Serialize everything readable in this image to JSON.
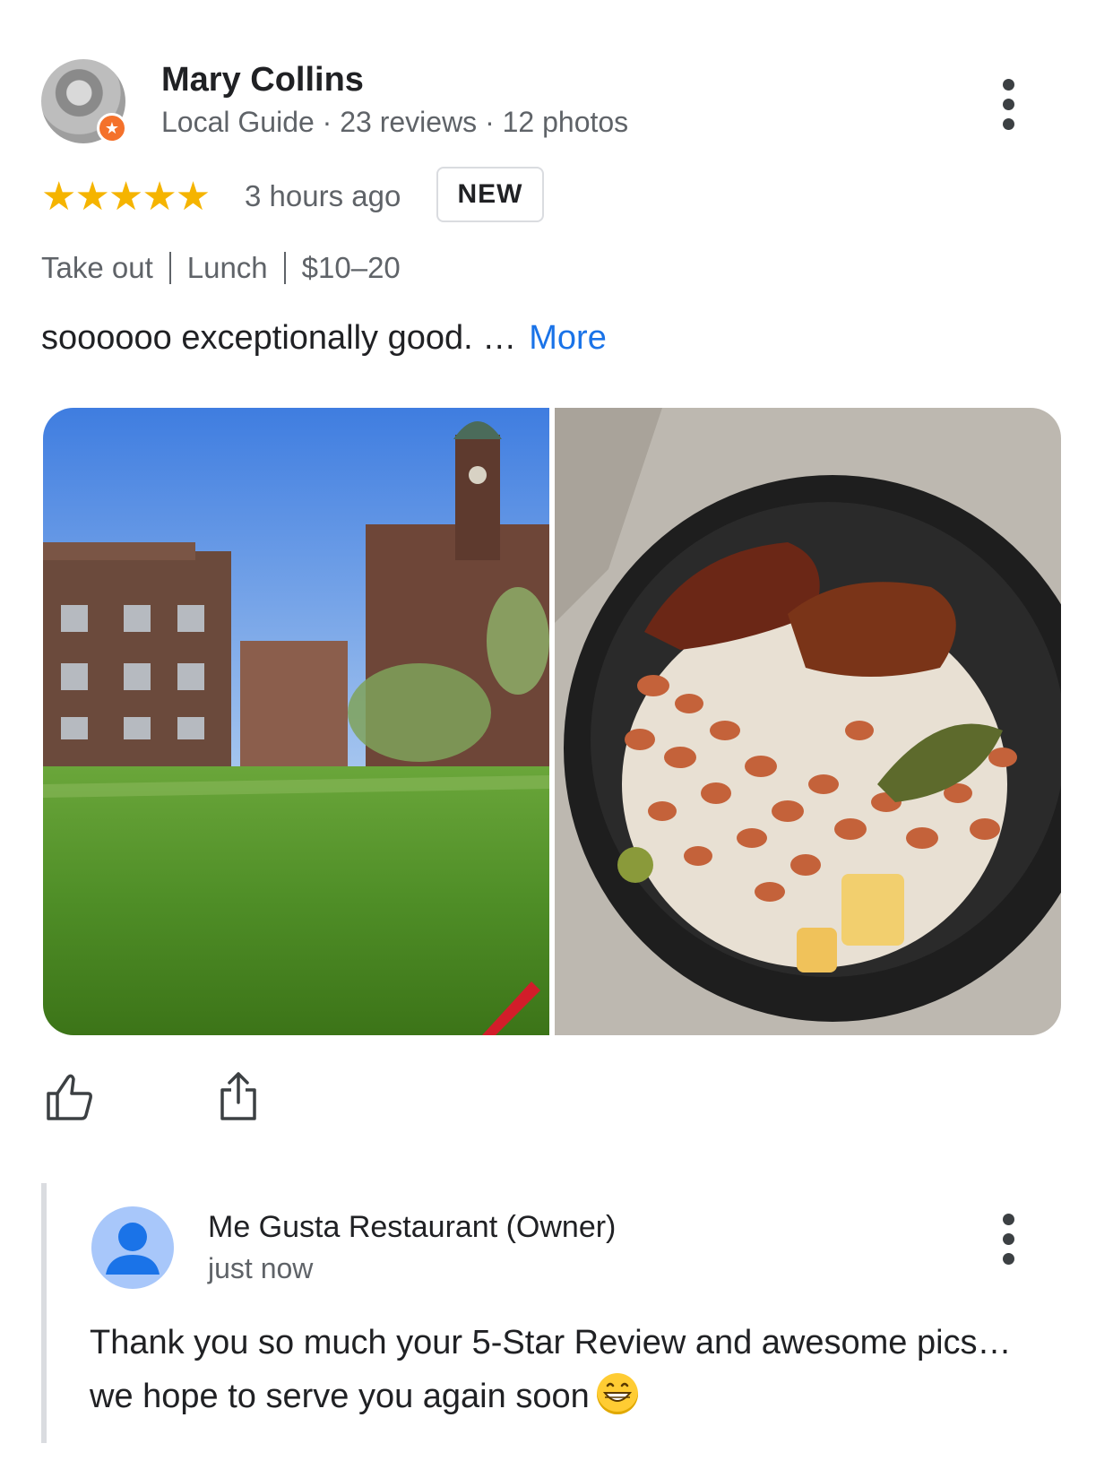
{
  "reviewer": {
    "name": "Mary Collins",
    "badge_icon": "local-guide-star-icon",
    "meta": "Local Guide · 23 reviews · 12 photos"
  },
  "rating": {
    "stars": 5,
    "stars_display": "★★★★★",
    "time": "3 hours ago",
    "badge": "NEW"
  },
  "tags": [
    "Take out",
    "Lunch",
    "$10–20"
  ],
  "review": {
    "text": "soooooo exceptionally good. …",
    "more_label": "More"
  },
  "photos": [
    {
      "icon": "photo-grass-buildings"
    },
    {
      "icon": "photo-food-bowl"
    }
  ],
  "actions": {
    "like_icon": "thumbs-up-icon",
    "share_icon": "share-icon"
  },
  "owner_reply": {
    "name": "Me Gusta Restaurant (Owner)",
    "time": "just now",
    "text": "Thank you so much your 5-Star Review and awesome pics… we hope to serve you again soon",
    "emoji_icon": "grinning-face-icon"
  },
  "colors": {
    "accent_link": "#1a73e8",
    "star": "#f5b400",
    "secondary_text": "#5f6368",
    "local_guide_badge": "#f4712b"
  }
}
